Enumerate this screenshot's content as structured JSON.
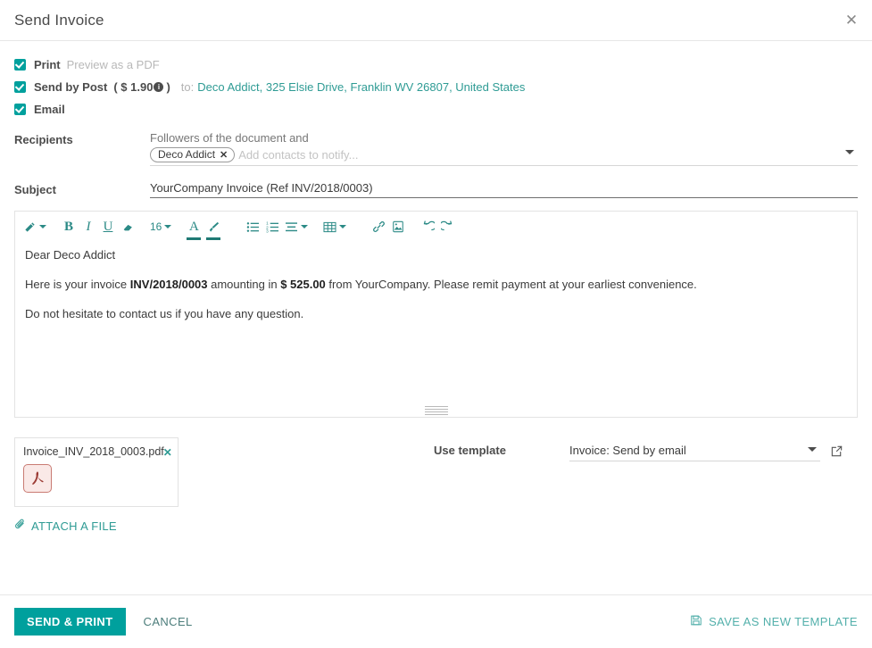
{
  "dialog": {
    "title": "Send Invoice",
    "close_icon": "close-icon"
  },
  "options": [
    {
      "id": "print",
      "label": "Print",
      "sub": "Preview as a PDF",
      "checked": true
    },
    {
      "id": "send_by_post",
      "label": "Send by Post",
      "cost": "( $ 1.90",
      "cost_end": ")",
      "info_icon": "info-icon",
      "to_prefix": "to:",
      "to_address": "Deco Addict, 325 Elsie Drive, Franklin WV 26807, United States",
      "checked": true
    },
    {
      "id": "email",
      "label": "Email",
      "checked": true
    }
  ],
  "recipients": {
    "label": "Recipients",
    "followers_text": "Followers of the document and",
    "tags": [
      {
        "name": "Deco Addict",
        "remove_icon": "close-icon"
      }
    ],
    "placeholder": "Add contacts to notify...",
    "dropdown_icon": "chevron-down-icon"
  },
  "subject": {
    "label": "Subject",
    "value": "YourCompany Invoice (Ref INV/2018/0003)"
  },
  "editor": {
    "toolbar": [
      {
        "name": "style-wand-icon",
        "label": "",
        "type": "icon-caret"
      },
      {
        "name": "bold-button",
        "label": "B",
        "type": "bold"
      },
      {
        "name": "italic-button",
        "label": "I",
        "type": "italic"
      },
      {
        "name": "underline-button",
        "label": "U",
        "type": "underline"
      },
      {
        "name": "remove-format-icon",
        "label": "",
        "type": "eraser"
      },
      {
        "name": "font-size-select",
        "label": "16",
        "type": "size-caret"
      },
      {
        "name": "font-color-button",
        "label": "A",
        "type": "fontcolor"
      },
      {
        "name": "background-color-button",
        "label": "",
        "type": "bgcolor"
      },
      {
        "name": "unordered-list-button",
        "label": "",
        "type": "ul"
      },
      {
        "name": "ordered-list-button",
        "label": "",
        "type": "ol"
      },
      {
        "name": "align-button",
        "label": "",
        "type": "align-caret"
      },
      {
        "name": "table-button",
        "label": "",
        "type": "table-caret"
      },
      {
        "name": "link-button",
        "label": "",
        "type": "link"
      },
      {
        "name": "image-button",
        "label": "",
        "type": "image"
      },
      {
        "name": "undo-button",
        "label": "",
        "type": "undo"
      },
      {
        "name": "redo-button",
        "label": "",
        "type": "redo"
      }
    ],
    "font_size": "16",
    "body": {
      "greeting": "Dear Deco Addict",
      "line2_pre": "Here is your invoice ",
      "line2_invoice": "INV/2018/0003",
      "line2_mid": " amounting in ",
      "line2_amount": "$ 525.00",
      "line2_post": " from YourCompany. Please remit payment at your earliest convenience.",
      "line3": "Do not hesitate to contact us if you have any question."
    }
  },
  "attachments": {
    "files": [
      {
        "name": "Invoice_INV_2018_0003.pdf",
        "remove_icon": "close-icon",
        "type_icon": "pdf-icon"
      }
    ],
    "attach_label": "ATTACH A FILE",
    "attach_icon": "paperclip-icon"
  },
  "template": {
    "label": "Use template",
    "value": "Invoice: Send by email",
    "dropdown_icon": "chevron-down-icon",
    "external_icon": "external-link-icon"
  },
  "footer": {
    "primary_label": "SEND & PRINT",
    "cancel_label": "CANCEL",
    "save_template_label": "SAVE AS NEW TEMPLATE",
    "save_icon": "floppy-disk-icon"
  },
  "colors": {
    "accent": "#00a09d",
    "link": "#2e9b94",
    "toolbar": "#2b8a86",
    "pdf_border": "#c97b73",
    "pdf_bg": "#fae9e7"
  }
}
